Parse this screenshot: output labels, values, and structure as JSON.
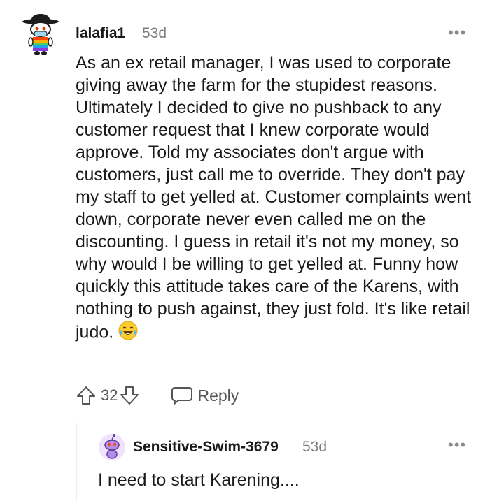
{
  "comment": {
    "username": "lalafia1",
    "time": "53d",
    "more_icon": "•••",
    "body": "As an ex retail manager, I was used to corporate giving away the farm for the stupidest reasons. Ultimately I decided to give no pushback to any customer request that I knew corporate would approve. Told my associates don't argue with customers, just call me to override. They don't pay my staff to get yelled at. Customer complaints went down, corporate never even called me on the discounting. I guess in retail it's not my money, so why would I be willing to get yelled at. Funny how quickly this attitude takes care of the Karens, with nothing to push against, they just fold. It's like retail judo.",
    "emoji": "laughing-tears-emoji",
    "vote_count": "32",
    "reply_label": "Reply"
  },
  "reply": {
    "username": "Sensitive-Swim-3679",
    "time": "53d",
    "more_icon": "•••",
    "body": "I need to start Karening...."
  },
  "colors": {
    "text": "#1a1a1b",
    "meta": "#7c7c7c",
    "icon": "#878a8c",
    "thread_line": "#edeff1"
  }
}
